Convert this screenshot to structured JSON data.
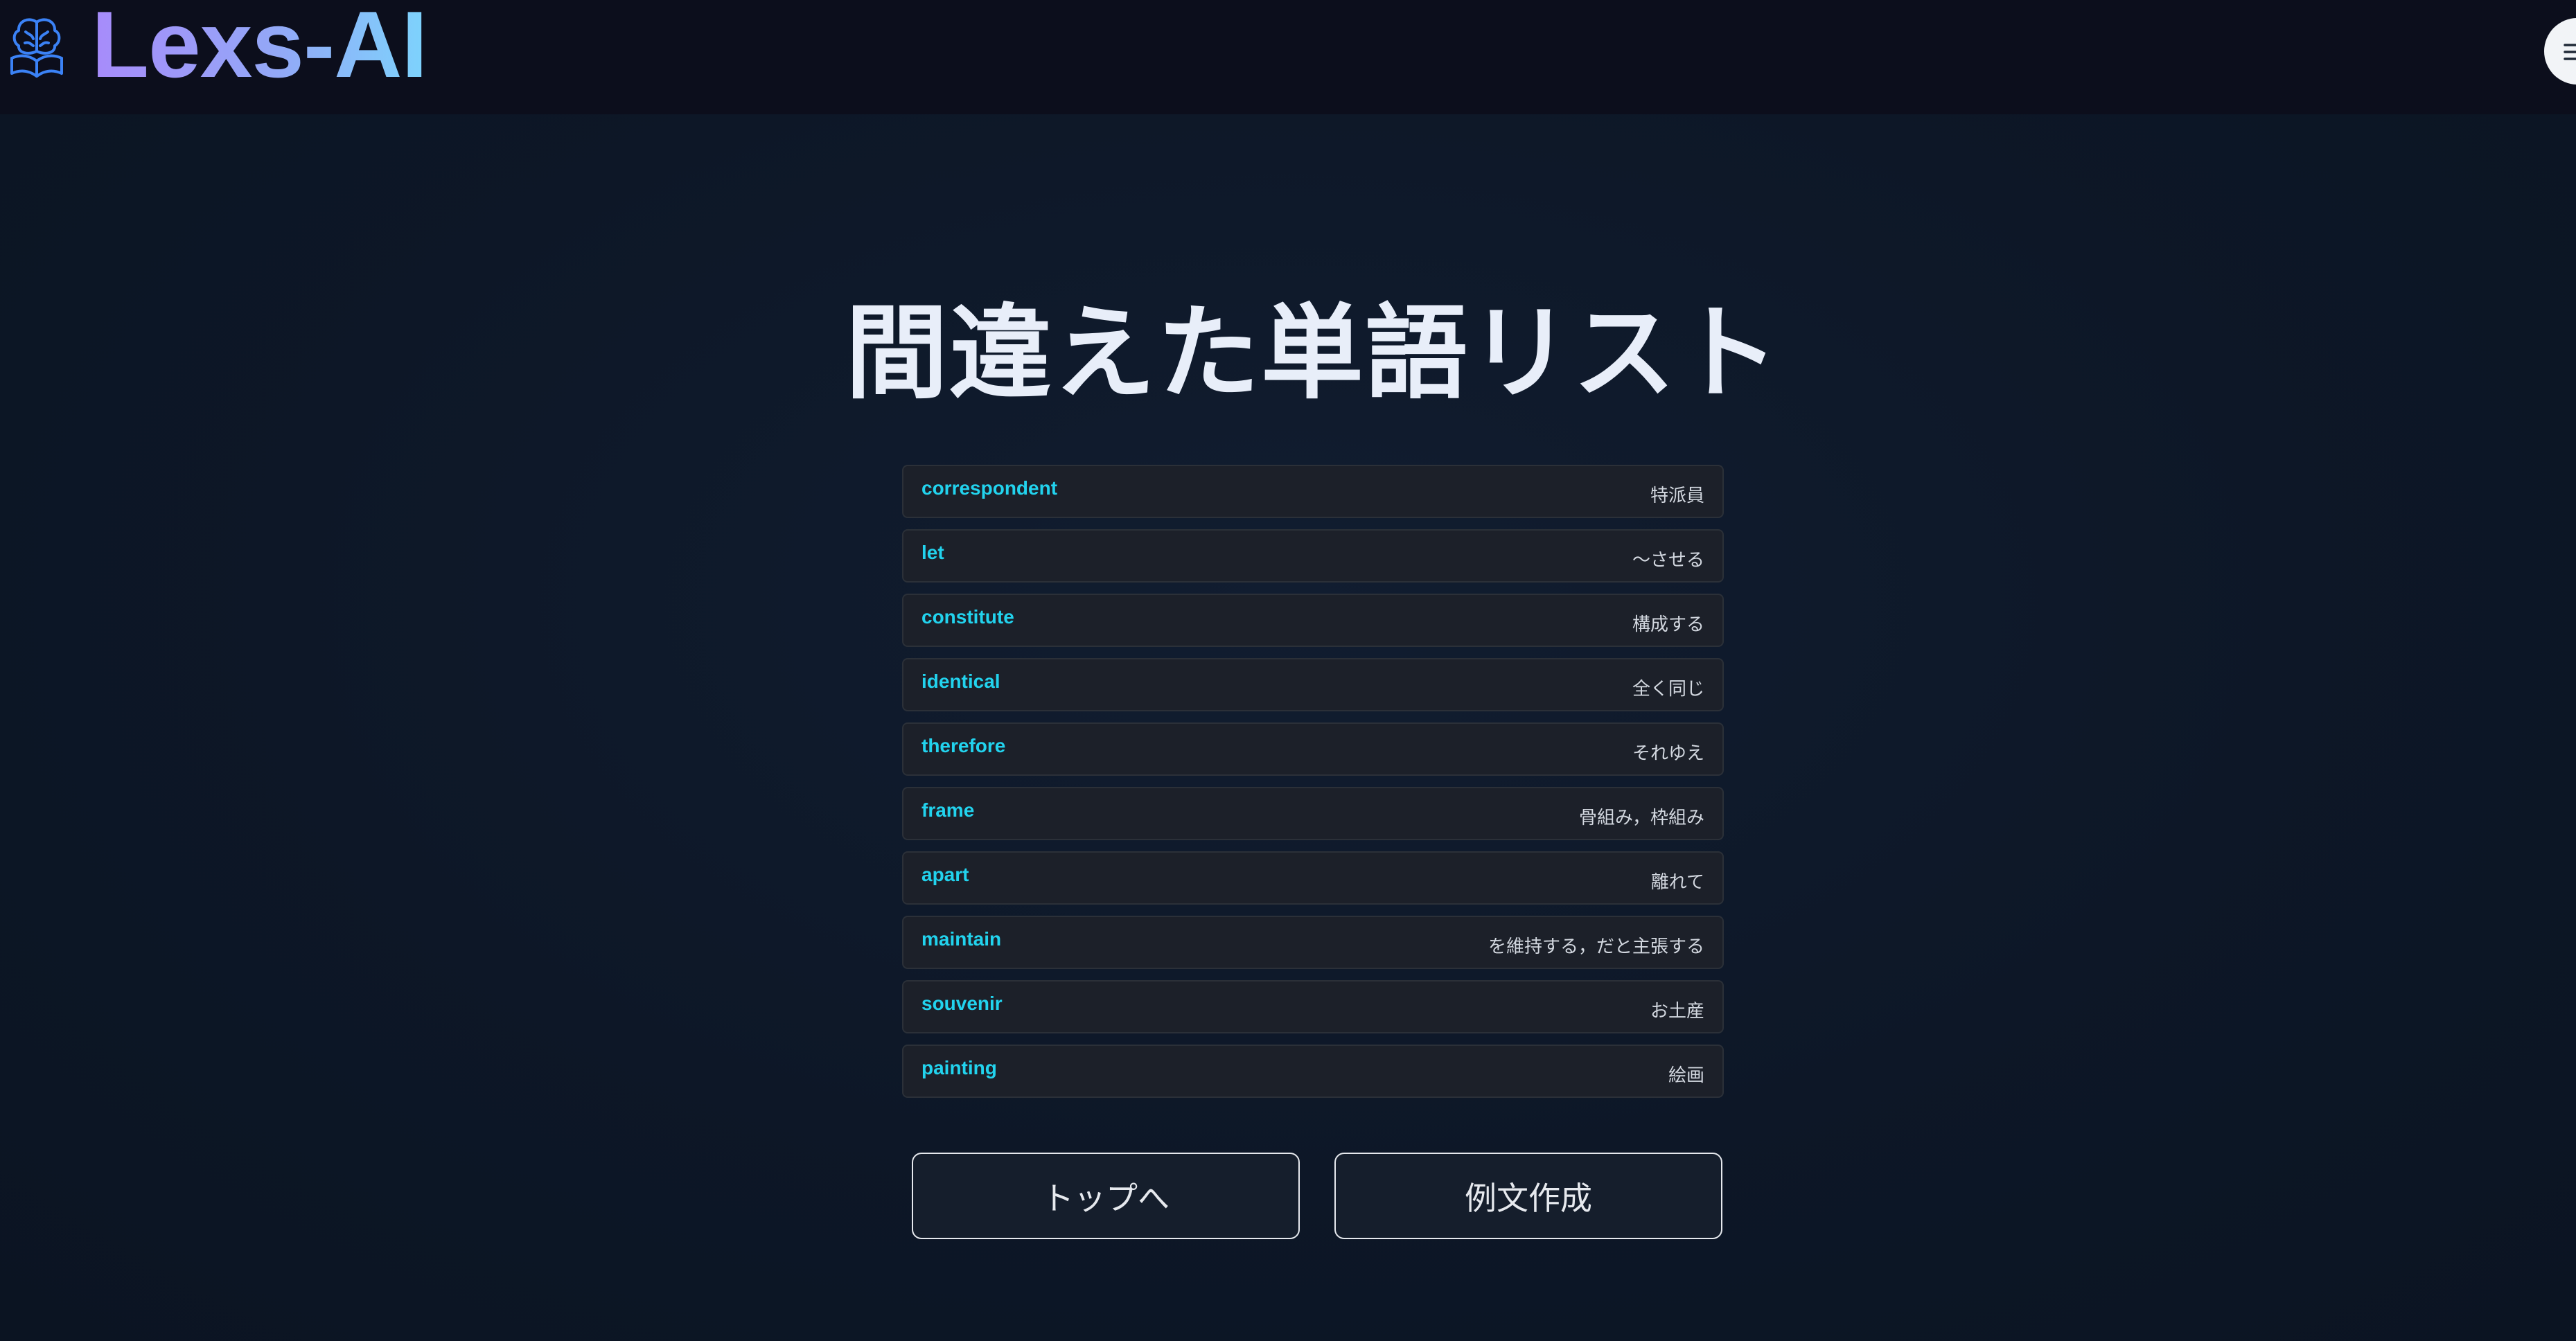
{
  "app": {
    "brand": "Lexs-AI"
  },
  "page": {
    "title": "間違えた単語リスト"
  },
  "words": [
    {
      "en": "correspondent",
      "ja": "特派員"
    },
    {
      "en": "let",
      "ja": "〜させる"
    },
    {
      "en": "constitute",
      "ja": "構成する"
    },
    {
      "en": "identical",
      "ja": "全く同じ"
    },
    {
      "en": "therefore",
      "ja": "それゆえ"
    },
    {
      "en": "frame",
      "ja": "骨組み，枠組み"
    },
    {
      "en": "apart",
      "ja": "離れて"
    },
    {
      "en": "maintain",
      "ja": "を維持する，だと主張する"
    },
    {
      "en": "souvenir",
      "ja": "お土産"
    },
    {
      "en": "painting",
      "ja": "絵画"
    }
  ],
  "buttons": {
    "top": "トップへ",
    "example": "例文作成"
  },
  "icons": {
    "logo": "brain-book-icon",
    "menu": "hamburger-menu-icon"
  },
  "colors": {
    "accent": "#22d3ee",
    "brand_gradient_start": "#a78bfa",
    "brand_gradient_end": "#7dd3fc",
    "background": "#0d1625"
  }
}
